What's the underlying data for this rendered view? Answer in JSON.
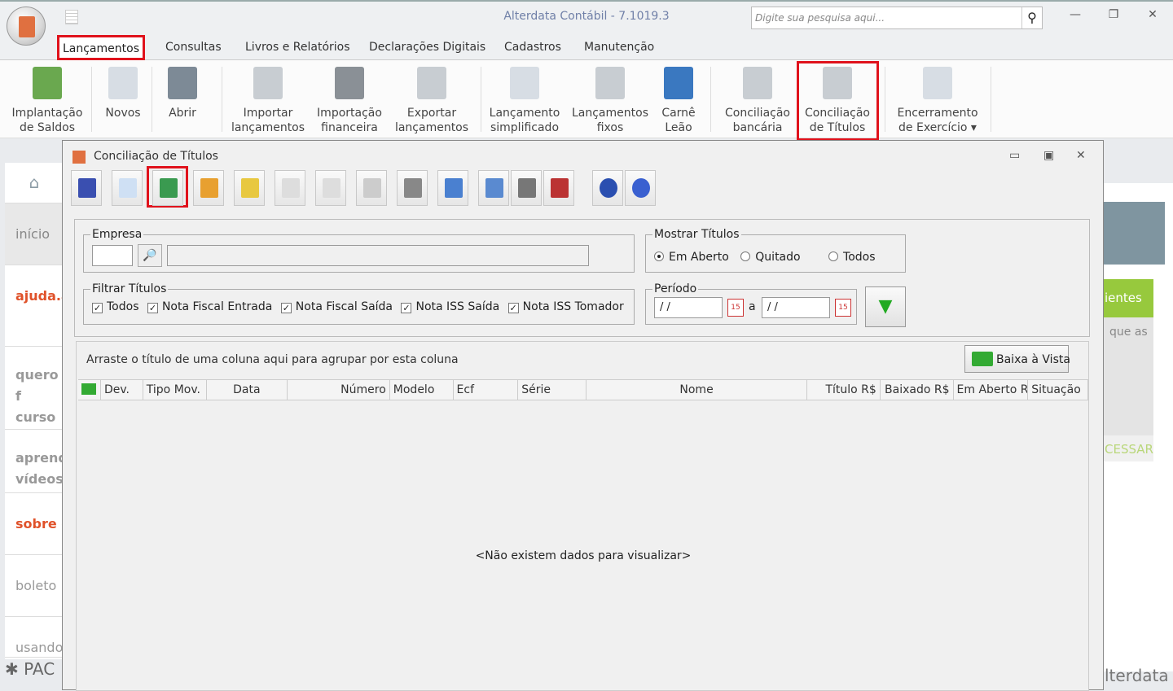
{
  "app": {
    "title": "Alterdata Contábil - 7.1019.3",
    "search_placeholder": "Digite sua pesquisa aqui..."
  },
  "tabs": [
    "Lançamentos",
    "Consultas",
    "Livros e Relatórios",
    "Declarações Digitais",
    "Cadastros",
    "Manutenção"
  ],
  "ribbon": [
    {
      "l1": "Implantação",
      "l2": "de Saldos",
      "color": "#6aa84f"
    },
    {
      "l1": "Novos",
      "l2": "",
      "color": "#d7dde4"
    },
    {
      "l1": "Abrir",
      "l2": "",
      "color": "#7d8a96"
    },
    {
      "l1": "Importar",
      "l2": "lançamentos",
      "color": "#c8cdd2"
    },
    {
      "l1": "Importação",
      "l2": "financeira",
      "color": "#8a9096"
    },
    {
      "l1": "Exportar",
      "l2": "lançamentos",
      "color": "#c8cdd2"
    },
    {
      "l1": "Lançamento",
      "l2": "simplificado",
      "color": "#d7dde4"
    },
    {
      "l1": "Lançamentos",
      "l2": "fixos",
      "color": "#c8cdd2"
    },
    {
      "l1": "Carnê",
      "l2": "Leão",
      "color": "#3a78c0"
    },
    {
      "l1": "Conciliação",
      "l2": "bancária",
      "color": "#c8cdd2"
    },
    {
      "l1": "Conciliação",
      "l2": "de Títulos",
      "color": "#c8cdd2"
    },
    {
      "l1": "Encerramento",
      "l2": "de Exercício ▾",
      "color": "#d7dde4"
    }
  ],
  "sidebar": [
    "início",
    "ajuda.a",
    "quero f curso",
    "aprend vídeos",
    "sobre c",
    "boleto",
    "usando"
  ],
  "sidebar_footer": "PAC",
  "right_panel": {
    "green_label": "ientes",
    "text": "que as",
    "link": "CESSAR",
    "logo": "lterdata"
  },
  "child": {
    "title": "Conciliação de Títulos",
    "empresa": {
      "legend": "Empresa",
      "code": "",
      "name": ""
    },
    "mostrar": {
      "legend": "Mostrar Títulos",
      "options": [
        "Em Aberto",
        "Quitado",
        "Todos"
      ],
      "selected": "Em Aberto"
    },
    "filtrar": {
      "legend": "Filtrar Títulos",
      "options": [
        "Todos",
        "Nota Fiscal Entrada",
        "Nota Fiscal Saída",
        "Nota ISS Saída",
        "Nota ISS Tomador"
      ]
    },
    "periodo": {
      "legend": "Período",
      "from": "/ /",
      "sep": "a",
      "to": "/ /"
    },
    "group_hint": "Arraste o título de uma coluna aqui para agrupar por esta coluna",
    "baixa_button": "Baixa à Vista",
    "columns": [
      "Dev.",
      "Tipo Mov.",
      "Data",
      "Número",
      "Modelo",
      "Ecf",
      "Série",
      "Nome",
      "Título R$",
      "Baixado R$",
      "Em Aberto R",
      "Situação"
    ],
    "empty": "<Não existem dados para visualizar>"
  }
}
